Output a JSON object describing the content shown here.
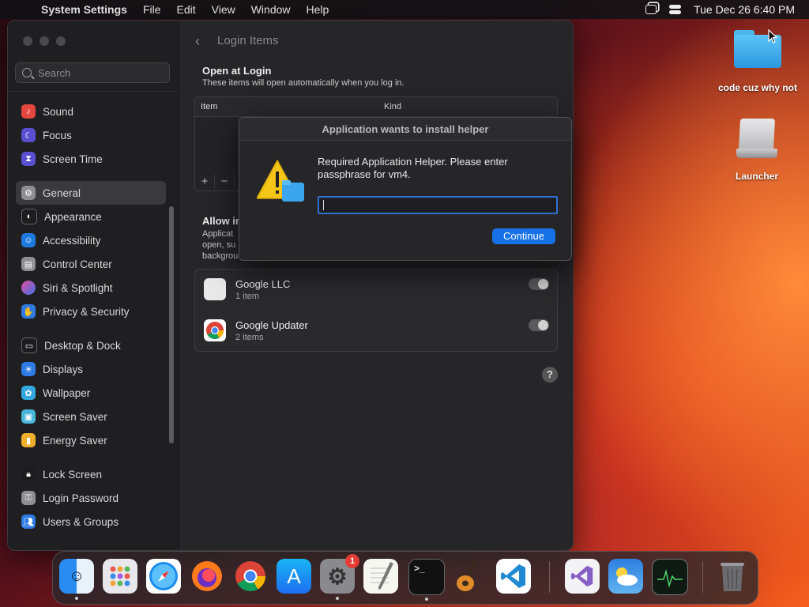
{
  "menubar": {
    "app": "System Settings",
    "menus": [
      "File",
      "Edit",
      "View",
      "Window",
      "Help"
    ],
    "clock": "Tue Dec 26  6:40 PM"
  },
  "sidebar": {
    "search_placeholder": "Search",
    "items": [
      {
        "label": "Sound",
        "icon": "speaker-icon",
        "color": "#e3473d"
      },
      {
        "label": "Focus",
        "icon": "moon-icon",
        "color": "#5b4fd1"
      },
      {
        "label": "Screen Time",
        "icon": "hourglass-icon",
        "color": "#5b4fd1"
      },
      {
        "label": "General",
        "icon": "gear-icon",
        "color": "#8e8e93"
      },
      {
        "label": "Appearance",
        "icon": "appearance-icon",
        "color": "#1c1c1e"
      },
      {
        "label": "Accessibility",
        "icon": "accessibility-icon",
        "color": "#1f7ae0"
      },
      {
        "label": "Control Center",
        "icon": "control-center-icon",
        "color": "#8e8e93"
      },
      {
        "label": "Siri & Spotlight",
        "icon": "siri-icon",
        "color": "#b94fd0"
      },
      {
        "label": "Privacy & Security",
        "icon": "hand-icon",
        "color": "#2f7be5"
      },
      {
        "label": "Desktop & Dock",
        "icon": "desktop-icon",
        "color": "#1c1c1e"
      },
      {
        "label": "Displays",
        "icon": "sun-icon",
        "color": "#2f7be5"
      },
      {
        "label": "Wallpaper",
        "icon": "wallpaper-icon",
        "color": "#35a7df"
      },
      {
        "label": "Screen Saver",
        "icon": "screen-saver-icon",
        "color": "#48b6d8"
      },
      {
        "label": "Energy Saver",
        "icon": "battery-icon",
        "color": "#f1b02b"
      },
      {
        "label": "Lock Screen",
        "icon": "lock-icon",
        "color": "#1c1c1e"
      },
      {
        "label": "Login Password",
        "icon": "key-icon",
        "color": "#8e8e93"
      },
      {
        "label": "Users & Groups",
        "icon": "users-icon",
        "color": "#2f7be5"
      }
    ]
  },
  "content": {
    "title": "Login Items",
    "open_at_login": "Open at Login",
    "open_at_login_sub": "These items will open automatically when you log in.",
    "columns": [
      "Item",
      "Kind"
    ],
    "add": "+",
    "remove": "−",
    "allow_title": "Allow in",
    "allow_sub": "Applicat open, su backgrou",
    "background_items": [
      {
        "name": "Google LLC",
        "count": "1 item"
      },
      {
        "name": "Google Updater",
        "count": "2 items"
      }
    ],
    "help": "?"
  },
  "dialog": {
    "title": "Application wants to install helper",
    "message": "Required Application Helper. Please enter passphrase for vm4.",
    "input_value": "",
    "button": "Continue"
  },
  "desktop": {
    "folder_label": "code cuz why not",
    "drive_label": "Launcher"
  },
  "dock": {
    "items": [
      {
        "name": "Finder",
        "icon": "finder-icon"
      },
      {
        "name": "Launchpad",
        "icon": "launchpad-icon"
      },
      {
        "name": "Safari",
        "icon": "safari-icon"
      },
      {
        "name": "Firefox",
        "icon": "firefox-icon"
      },
      {
        "name": "Chrome",
        "icon": "chrome-icon"
      },
      {
        "name": "App Store",
        "icon": "app-store-icon"
      },
      {
        "name": "System Settings",
        "icon": "settings-icon",
        "badge": "1"
      },
      {
        "name": "TextEdit",
        "icon": "textedit-icon"
      },
      {
        "name": "Terminal",
        "icon": "terminal-icon"
      },
      {
        "name": "GarageBand",
        "icon": "garageband-icon"
      },
      {
        "name": "VS Code",
        "icon": "vscode-icon"
      },
      {
        "name": "Visual Studio",
        "icon": "visual-studio-icon"
      },
      {
        "name": "Weather",
        "icon": "weather-icon"
      },
      {
        "name": "Activity Monitor",
        "icon": "activity-monitor-icon"
      },
      {
        "name": "Trash",
        "icon": "trash-icon"
      }
    ]
  }
}
